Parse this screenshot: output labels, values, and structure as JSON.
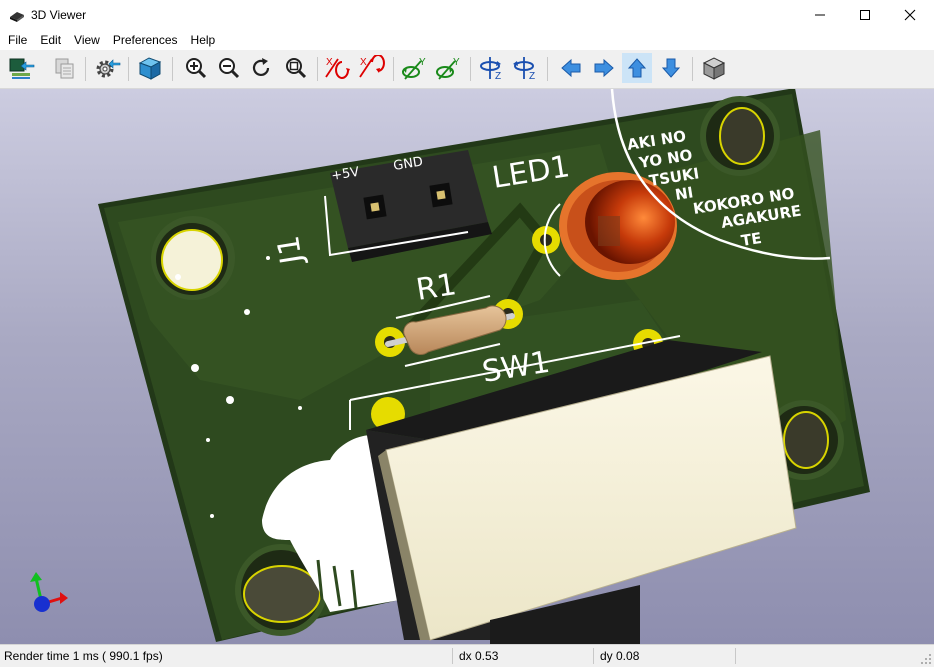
{
  "window": {
    "title": "3D Viewer"
  },
  "menu": [
    "File",
    "Edit",
    "View",
    "Preferences",
    "Help"
  ],
  "toolbar": {
    "buttons": [
      {
        "name": "reload-board-icon"
      },
      {
        "name": "copy-image-icon"
      },
      {
        "name": "settings-icon"
      },
      {
        "name": "raytracing-toggle-icon"
      },
      {
        "name": "zoom-in-icon"
      },
      {
        "name": "zoom-out-icon"
      },
      {
        "name": "redraw-icon"
      },
      {
        "name": "zoom-fit-icon"
      },
      {
        "name": "rotate-x-cw-icon",
        "axis": "X"
      },
      {
        "name": "rotate-x-ccw-icon",
        "axis": "X"
      },
      {
        "name": "rotate-y-cw-icon",
        "axis": "Y"
      },
      {
        "name": "rotate-y-ccw-icon",
        "axis": "Y"
      },
      {
        "name": "rotate-z-cw-icon",
        "axis": "Z"
      },
      {
        "name": "rotate-z-ccw-icon",
        "axis": "Z"
      },
      {
        "name": "move-left-icon"
      },
      {
        "name": "move-right-icon"
      },
      {
        "name": "move-up-icon",
        "active": true
      },
      {
        "name": "move-down-icon"
      },
      {
        "name": "orthographic-toggle-icon"
      }
    ]
  },
  "pcb": {
    "silkscreen": {
      "j1": "J1",
      "plus5v": "+5V",
      "gnd": "GND",
      "led1": "LED1",
      "r1": "R1",
      "sw1": "SW1",
      "poem": [
        "AKI NO",
        "YO NO",
        "TSUKI",
        "NI",
        "KOKORO NO",
        "AGAKURE",
        "TE"
      ]
    },
    "colors": {
      "board": "#2f4a1f",
      "soldermask_edge": "#3c5a28",
      "silk": "#ffffff",
      "pad": "#e8d800",
      "hole": "#2a2a1e"
    }
  },
  "status": {
    "render_time": "Render time 1 ms ( 990.1 fps)",
    "dx": "dx 0.53",
    "dy": "dy 0.08"
  }
}
